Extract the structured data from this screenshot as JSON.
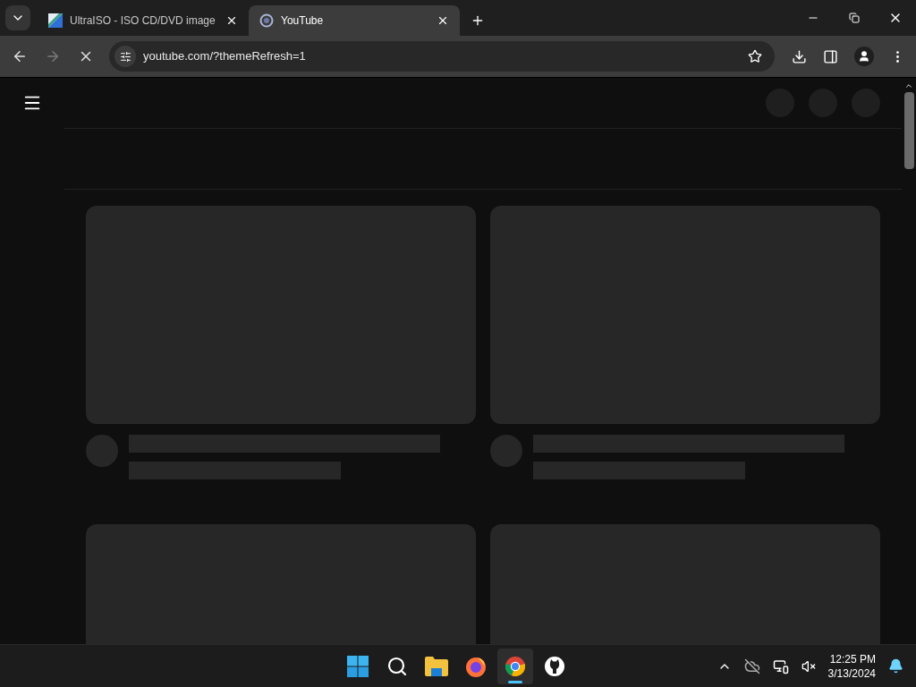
{
  "tabs": [
    {
      "title": "UltraISO - ISO CD/DVD image",
      "kind": "ultraiso",
      "selected": false
    },
    {
      "title": "YouTube",
      "kind": "loading",
      "selected": true
    }
  ],
  "toolbar": {
    "back": {
      "disabled": false
    },
    "forward": {
      "disabled": true
    },
    "loading": true,
    "url": "youtube.com/?themeRefresh=1"
  },
  "taskbar": {
    "apps": [
      {
        "kind": "start",
        "selected": false
      },
      {
        "kind": "search",
        "selected": false
      },
      {
        "kind": "files",
        "selected": false
      },
      {
        "kind": "firefox",
        "selected": false
      },
      {
        "kind": "chrome",
        "selected": true
      },
      {
        "kind": "github",
        "selected": false
      }
    ],
    "time": "12:25 PM",
    "date": "3/13/2024"
  }
}
